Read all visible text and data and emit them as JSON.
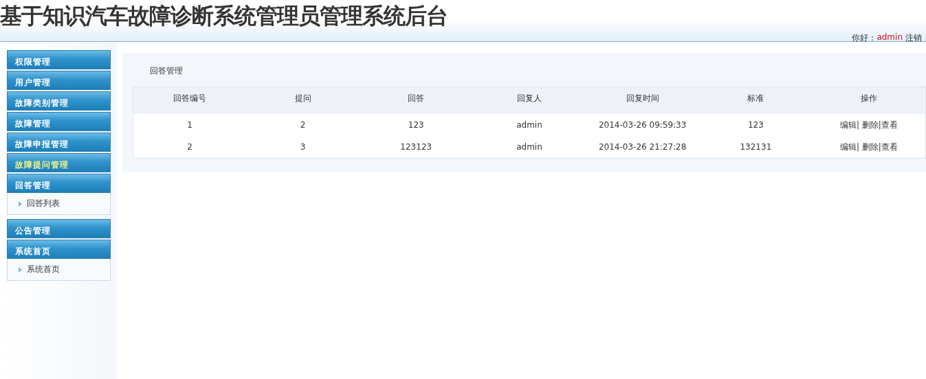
{
  "header": {
    "title": "基于知识汽车故障诊断系统管理员管理系统后台",
    "greeting": "你好：",
    "user": "admin",
    "logout": "注销"
  },
  "sidebar": {
    "groups": [
      {
        "label": "权限管理",
        "selected": false
      },
      {
        "label": "用户管理",
        "selected": false
      },
      {
        "label": "故障类别管理",
        "selected": false
      },
      {
        "label": "故障管理",
        "selected": false
      },
      {
        "label": "故障申报管理",
        "selected": false
      },
      {
        "label": "故障提问管理",
        "selected": true
      },
      {
        "label": "回答管理",
        "selected": false,
        "children": [
          "回答列表"
        ]
      },
      {
        "label": "公告管理",
        "selected": false
      },
      {
        "label": "系统首页",
        "selected": false,
        "children": [
          "系统首页"
        ]
      }
    ]
  },
  "main": {
    "title": "回答管理",
    "table": {
      "columns": [
        "回答编号",
        "提问",
        "回答",
        "回复人",
        "回复时间",
        "标准",
        "操作"
      ],
      "action_separator": "|",
      "rows": [
        {
          "cells": [
            "1",
            "2",
            "123",
            "admin",
            "2014-03-26 09:59:33",
            "123"
          ],
          "actions": [
            "编辑",
            "删除",
            "查看"
          ]
        },
        {
          "cells": [
            "2",
            "3",
            "123123",
            "admin",
            "2014-03-26 21:27:28",
            "132131"
          ],
          "actions": [
            "编辑",
            "删除",
            "查看"
          ]
        }
      ]
    }
  }
}
